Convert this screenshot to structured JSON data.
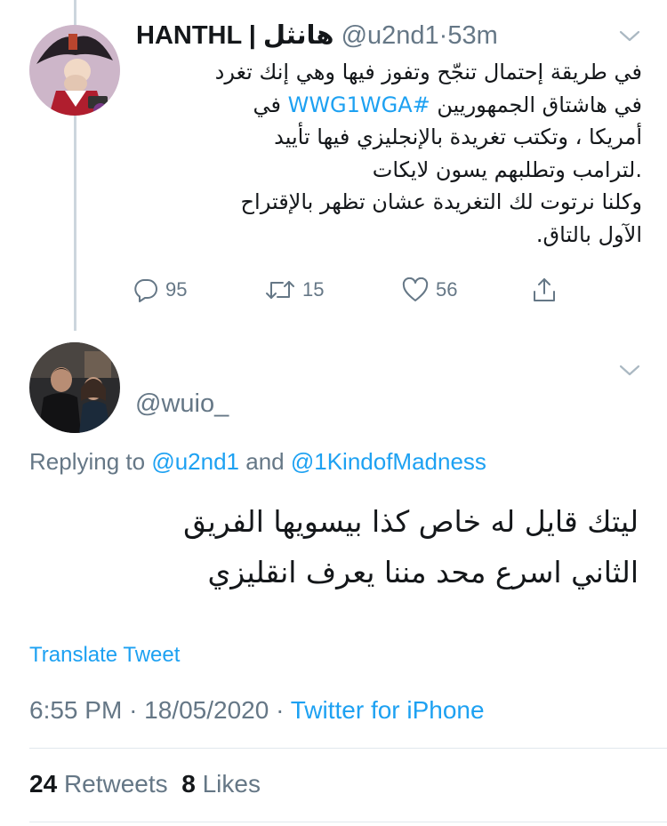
{
  "tweet1": {
    "name": "HANTHL | هانثل",
    "handle": "@u2nd1",
    "time": "53m",
    "separator": "·",
    "lines": [
      {
        "text": "في طريقة إحتمال تنجّح وتفوز فيها وهي إنك تغرد"
      },
      {
        "text": "في هاشتاق الجمهوريين ",
        "hashtag": "#WWG1WGA",
        "after": " في"
      },
      {
        "text": "أمريكا ، وتكتب تغريدة بالإنجليزي فيها تأييد"
      },
      {
        "text": ".لترامب وتطلبهم يسون لايكات"
      },
      {
        "text": "وكلنا نرتوت لك التغريدة عشان تظهر بالإقتراح"
      },
      {
        "text": "الآول بالتاق."
      }
    ],
    "actions": {
      "replies": "95",
      "retweets": "15",
      "likes": "56"
    },
    "icons": {
      "reply": "speech-bubble-icon",
      "retweet": "retweet-arrows-icon",
      "like": "heart-icon",
      "share": "share-upload-icon",
      "menu": "chevron-down-icon"
    }
  },
  "tweet2": {
    "handle": "@wuio_",
    "replying_prefix": "Replying to ",
    "replying_to_1": "@u2nd1",
    "replying_and": " and ",
    "replying_to_2": "@1KindofMadness",
    "lines": [
      "ليتك قايل له خاص كذا بيسويها الفريق",
      "الثاني اسرع محد مننا يعرف انقليزي"
    ],
    "translate_label": "Translate Tweet",
    "time": "6:55 PM",
    "date": "18/05/2020",
    "separator": "·",
    "source": "Twitter for iPhone",
    "retweet_count": "24",
    "retweets_label": "Retweets",
    "like_count": "8",
    "likes_label": "Likes"
  },
  "colors": {
    "link": "#1da1f2",
    "secondary_text": "#657786",
    "primary_text": "#14171a",
    "divider": "#e1e8ed"
  }
}
